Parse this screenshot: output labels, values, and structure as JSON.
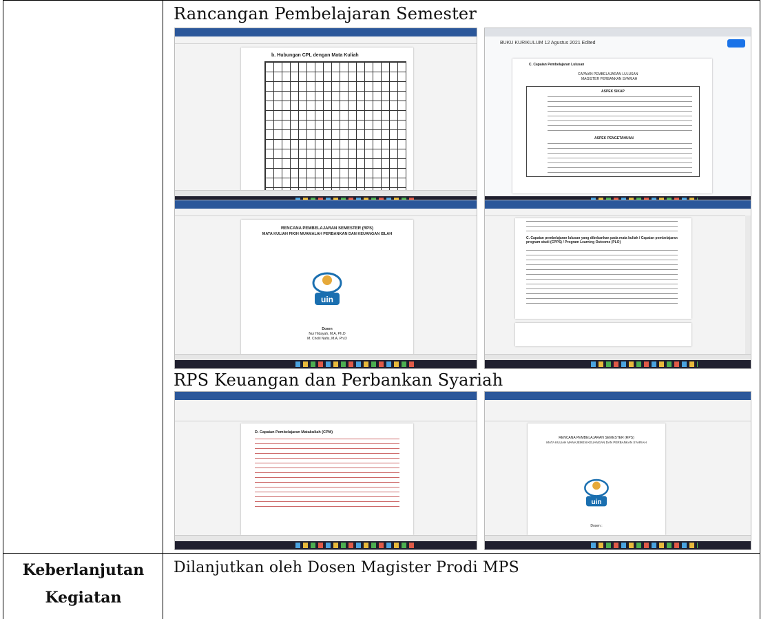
{
  "table": {
    "row1": {
      "left_label": "",
      "heading_top": "Rancangan Pembelajaran Semester",
      "heading_mid": "RPS Keuangan dan Perbankan Syariah"
    },
    "row2": {
      "left_label_line1": "Keberlanjutan",
      "left_label_line2": "Kegiatan",
      "content": "Dilanjutkan oleh Dosen Magister Prodi MPS"
    }
  },
  "screenshots": {
    "s1": {
      "doc_heading": "b. Hubungan CPL dengan Mata Kuliah",
      "app": "Word"
    },
    "s2": {
      "doc_heading": "C. Capaian Pembelajaran Lulusan",
      "sub1": "CAPAIAN PEMBELAJARAN LULUSAN",
      "sub2": "MAGISTER PERBANKAN SYARIAH",
      "sec1": "ASPEK SIKAP",
      "sec2": "ASPEK PENGETAHUAN",
      "doc_title": "BUKU KURIKULUM 12 Agustus 2021 Edited",
      "app": "Google Docs"
    },
    "s3": {
      "doc_title": "RENCANA PEMBELAJARAN SEMESTER (RPS)",
      "doc_sub": "MATA KULIAH FIKIH MUAMALAH PERBANKAN DAN KEUANGAN ISLAH",
      "logo": "uin",
      "dosen_label": "Dosen",
      "dosen1": "Nur Hidayah, M.A, Ph.D",
      "dosen2": "M. Cholil Nafis, M.A, Ph.D",
      "app": "Word"
    },
    "s4": {
      "doc_heading": "C. Capaian pembelajaran lulusan yang dibebankan pada mata kuliah / Capaian pembelajaran program studi (CPPS) / Program Learning Outcome (PLO)",
      "app": "Word"
    },
    "s5": {
      "doc_heading": "D. Capaian Pembelajaran Matakuliah (CPM)",
      "app": "Word"
    },
    "s6": {
      "doc_title": "RENCANA PEMBELAJARAN SEMESTER (RPS)",
      "doc_sub": "MATA KULIAH MANAJEMEN KEUANGAN DAN PERBANKAN SYARIAH",
      "logo": "uin",
      "dosen_label": "Dosen :",
      "app": "Word"
    }
  },
  "colors": {
    "word_blue": "#2b579a",
    "taskbar": "#1f1f2e",
    "uin_blue": "#1a6fb0"
  }
}
